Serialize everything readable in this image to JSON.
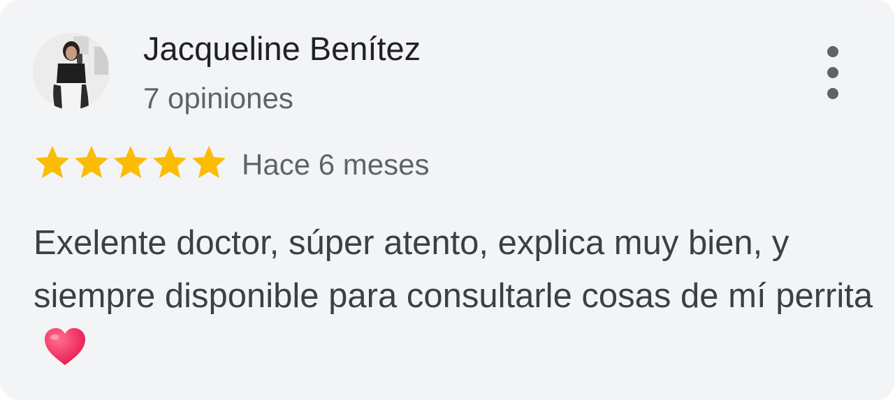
{
  "review": {
    "author_name": "Jacqueline Benítez",
    "author_reviews": "7 opiniones",
    "rating": 5,
    "rating_max": 5,
    "time_ago": "Hace 6 meses",
    "text": "Exelente doctor, súper atento, explica muy bien, y siempre disponible para consultarle cosas de mí perrita",
    "text_emoji": "heart-emoji"
  },
  "icons": {
    "menu": "more-vert-icon",
    "star": "star-icon"
  },
  "colors": {
    "card_background": "#f3f4f6",
    "name": "#202124",
    "secondary_text": "#5f6368",
    "body_text": "#3c4043",
    "star": "#fbbc04",
    "heart": "#f0245a"
  }
}
